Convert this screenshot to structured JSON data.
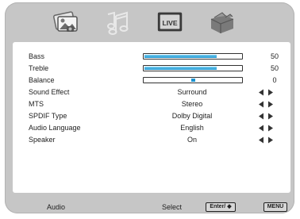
{
  "tabs": [
    {
      "name": "picture",
      "icon": "picture-icon",
      "active": false
    },
    {
      "name": "audio",
      "icon": "music-note-icon",
      "active": true
    },
    {
      "name": "live",
      "icon": "live-tv-icon",
      "label": "LIVE",
      "active": false
    },
    {
      "name": "setup",
      "icon": "toolbox-icon",
      "active": false
    }
  ],
  "settings": [
    {
      "label": "Bass",
      "type": "slider",
      "value": 50,
      "fill_percent": 75
    },
    {
      "label": "Treble",
      "type": "slider",
      "value": 50,
      "fill_percent": 75
    },
    {
      "label": "Balance",
      "type": "slider",
      "value": 0,
      "marker_percent": 50
    },
    {
      "label": "Sound Effect",
      "type": "option",
      "value": "Surround"
    },
    {
      "label": "MTS",
      "type": "option",
      "value": "Stereo"
    },
    {
      "label": "SPDIF Type",
      "type": "option",
      "value": "Dolby Digital"
    },
    {
      "label": "Audio Language",
      "type": "option",
      "value": "English"
    },
    {
      "label": "Speaker",
      "type": "option",
      "value": "On"
    }
  ],
  "footer": {
    "menu_name": "Audio",
    "select_label": "Select",
    "select_key": "Enter/ ◆",
    "menu_key": "MENU"
  },
  "colors": {
    "frame": "#c6c6c6",
    "slider_fill": "#1c93cf",
    "icon_gray": "#6f6f6f",
    "icon_active": "#e8e8e8"
  }
}
